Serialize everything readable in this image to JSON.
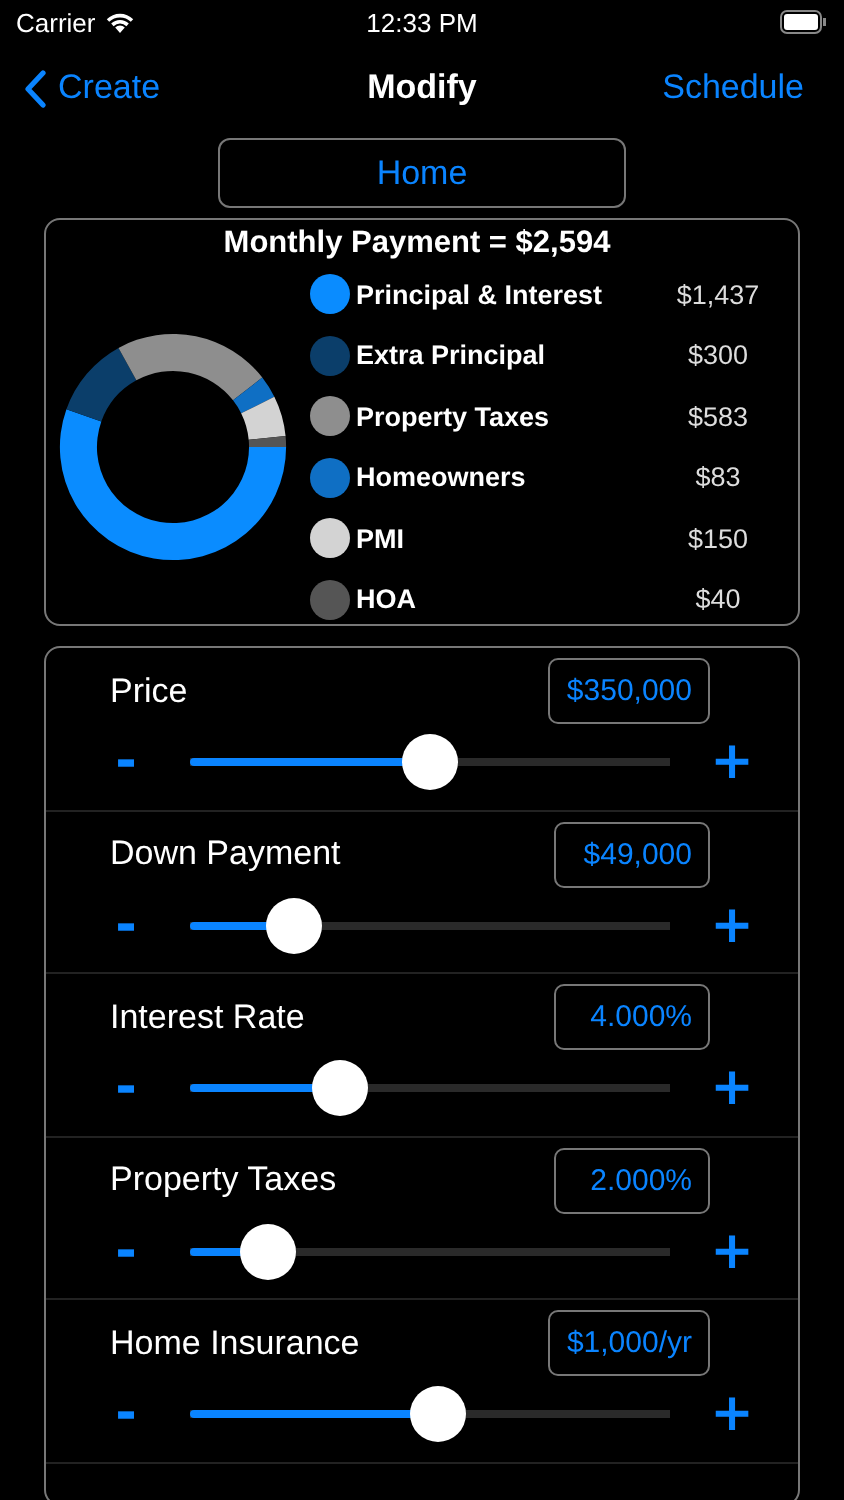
{
  "status_bar": {
    "carrier": "Carrier",
    "time": "12:33 PM"
  },
  "nav": {
    "back": "Create",
    "title": "Modify",
    "action": "Schedule"
  },
  "profile_button": "Home",
  "summary": {
    "chart_data": {
      "type": "donut",
      "title": "Monthly Payment = $2,594",
      "categories": [
        "Principal & Interest",
        "Extra Principal",
        "Property Taxes",
        "Homeowners",
        "PMI",
        "HOA"
      ],
      "series": [
        {
          "values": [
            55.43,
            11.57,
            22.48,
            3.2,
            5.78,
            1.54
          ]
        }
      ]
    },
    "legend": [
      {
        "amount": "$1,437",
        "color": "#0a8cff"
      },
      {
        "amount": "$300",
        "color": "#0b3e6a"
      },
      {
        "amount": "$583",
        "color": "#8e8e8e"
      },
      {
        "amount": "$83",
        "color": "#0f6fc4"
      },
      {
        "amount": "$150",
        "color": "#d3d3d3"
      },
      {
        "amount": "$40",
        "color": "#555555"
      }
    ]
  },
  "inputs": [
    {
      "label": "Price",
      "value": "$350,000",
      "level": 0.5,
      "minus": "-",
      "plus": "+"
    },
    {
      "label": "Down Payment",
      "value": "$49,000",
      "level": 0.18,
      "minus": "-",
      "plus": "+"
    },
    {
      "label": "Interest Rate",
      "value": "4.000%",
      "level": 0.29,
      "minus": "-",
      "plus": "+"
    },
    {
      "label": "Property Taxes",
      "value": "2.000%",
      "level": 0.12,
      "minus": "-",
      "plus": "+"
    },
    {
      "label": "Home Insurance",
      "value": "$1,000/yr",
      "level": 0.52,
      "minus": "-",
      "plus": "+"
    }
  ]
}
